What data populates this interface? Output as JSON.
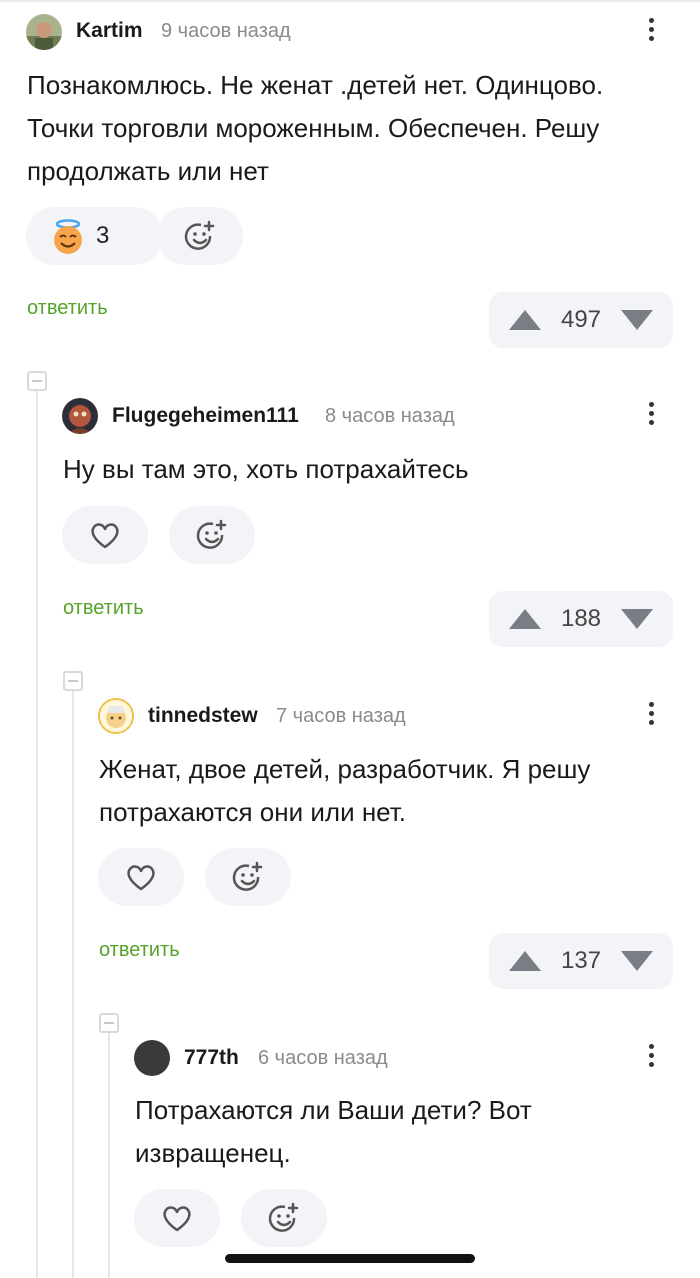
{
  "comments": [
    {
      "username": "Kartim",
      "time": "9 часов назад",
      "text_lines": [
        "Познакомлюсь. Не женат .детей нет. Одинцово.",
        "Точки торговли мороженным. Обеспечен. Решу",
        "продолжать или нет"
      ],
      "reaction_icon": "angel-face-emoji-icon",
      "reaction_count": "3",
      "reply_label": "ответить",
      "score": "497"
    },
    {
      "username": "Flugegeheimen111",
      "time": "8 часов назад",
      "text_lines": [
        "Ну вы там это, хоть потрахайтесь"
      ],
      "reply_label": "ответить",
      "score": "188"
    },
    {
      "username": "tinnedstew",
      "time": "7 часов назад",
      "text_lines": [
        "Женат, двое детей, разработчик. Я решу",
        "потрахаются они или нет."
      ],
      "reply_label": "ответить",
      "score": "137"
    },
    {
      "username": "777th",
      "time": "6 часов назад",
      "text_lines": [
        "Потрахаются ли Ваши дети? Вот",
        "извращенец."
      ]
    }
  ],
  "colors": {
    "reply_green": "#55a32a",
    "pill_bg": "#f3f4f8",
    "vote_arrow": "#7b7d86",
    "time_gray": "#8a8a8a"
  }
}
